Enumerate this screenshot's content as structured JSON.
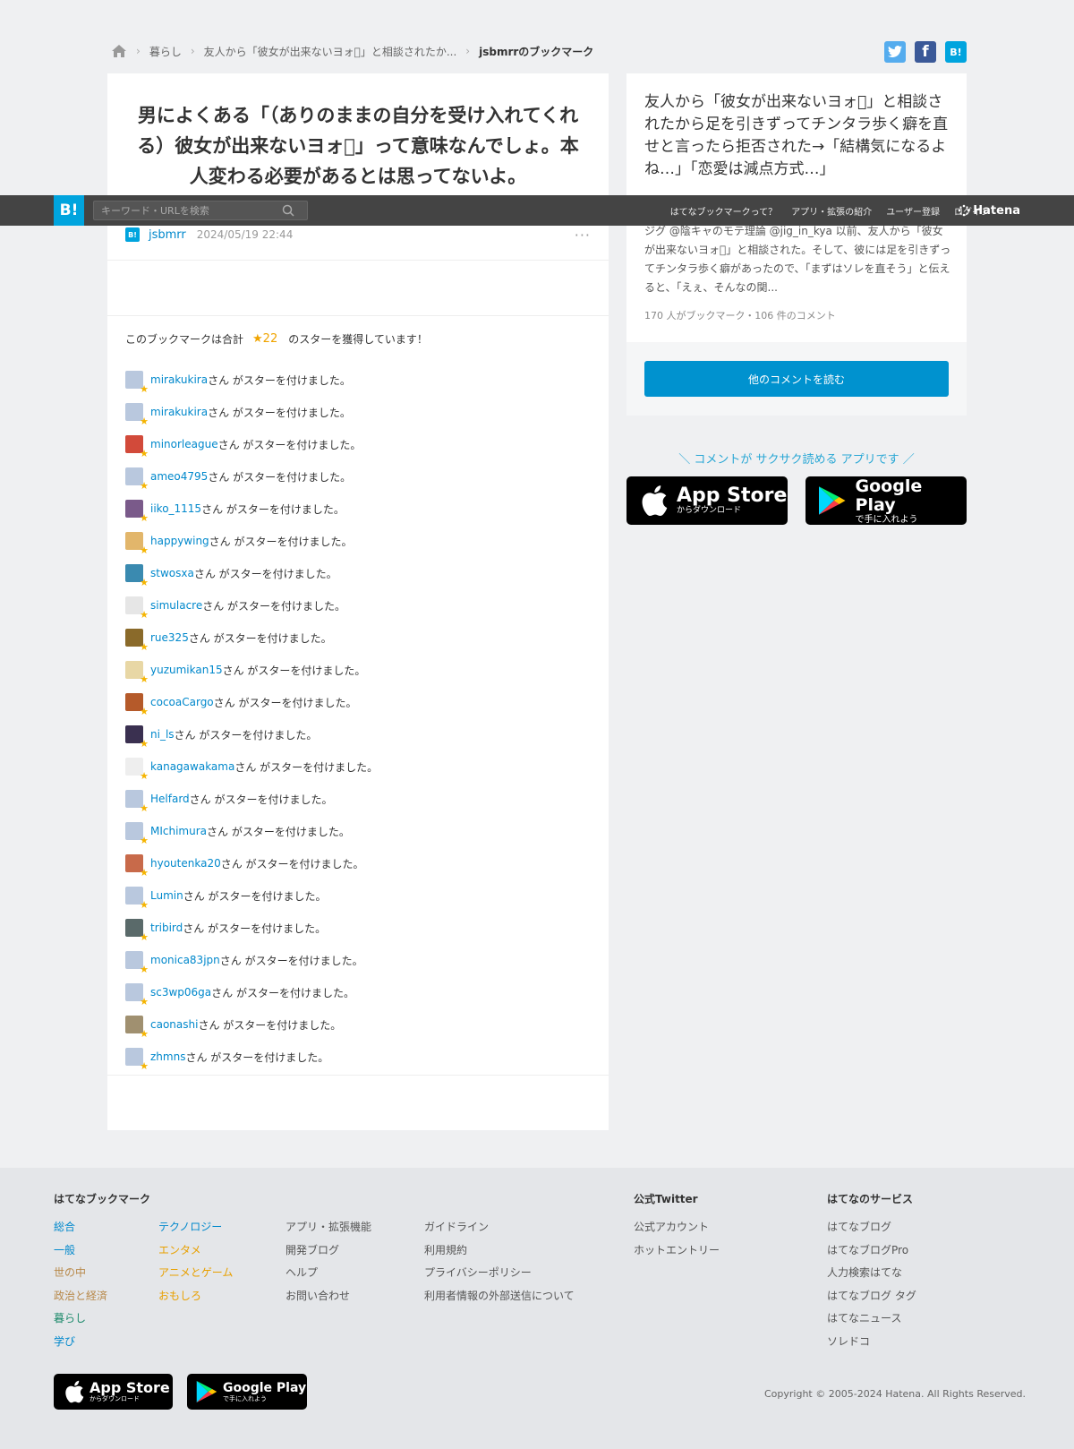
{
  "breadcrumb": {
    "items": [
      "暮らし",
      "友人から「彼女が出来ないヨォ\u0000」と相談されたか...",
      "jsbmrrのブックマーク"
    ]
  },
  "share": {
    "twitter": "t",
    "facebook": "f",
    "hatena": "B!"
  },
  "header": {
    "logo": "B!",
    "search_placeholder": "キーワード・URLを検索",
    "nav": [
      "はてなブックマークって？",
      "アプリ・拡張の紹介",
      "ユーザー登録",
      "ログイン"
    ],
    "brand": "Hatena"
  },
  "entry": {
    "title": "男によくある「（ありのままの自分を受け入れてくれる）彼女が出来ないヨォ\u0000」って意味なんでしょ。本人変わる必要があるとは思ってないよ。",
    "user": "jsbmrr",
    "timestamp": "2024/05/19 22:44",
    "more": "···",
    "star_summary_prefix": "このブックマークは合計",
    "star_count": "★22",
    "star_summary_suffix": "のスターを獲得しています！"
  },
  "stars": {
    "suffix": "さん がスターを付けました。",
    "users": [
      {
        "name": "mirakukira",
        "color": "#b9c8de"
      },
      {
        "name": "mirakukira",
        "color": "#b9c8de"
      },
      {
        "name": "minorleague",
        "color": "#d24a3a"
      },
      {
        "name": "ameo4795",
        "color": "#b9c8de"
      },
      {
        "name": "iiko_1115",
        "color": "#7a5a8a"
      },
      {
        "name": "happywing",
        "color": "#e2b66b"
      },
      {
        "name": "stwosxa",
        "color": "#3a8ab0"
      },
      {
        "name": "simulacre",
        "color": "#e6e6e6"
      },
      {
        "name": "rue325",
        "color": "#8a6a2a"
      },
      {
        "name": "yuzumikan15",
        "color": "#e8d7a5"
      },
      {
        "name": "cocoaCargo",
        "color": "#b55a2a"
      },
      {
        "name": "ni_ls",
        "color": "#3a3050"
      },
      {
        "name": "kanagawakama",
        "color": "#eeeeee"
      },
      {
        "name": "Helfard",
        "color": "#b9c8de"
      },
      {
        "name": "MIchimura",
        "color": "#b9c8de"
      },
      {
        "name": "hyoutenka20",
        "color": "#c86a4a"
      },
      {
        "name": "Lumin",
        "color": "#b9c8de"
      },
      {
        "name": "tribird",
        "color": "#5a6a6a"
      },
      {
        "name": "monica83jpn",
        "color": "#b9c8de"
      },
      {
        "name": "sc3wp06ga",
        "color": "#b9c8de"
      },
      {
        "name": "caonashi",
        "color": "#a09070"
      },
      {
        "name": "zhmns",
        "color": "#b9c8de"
      }
    ]
  },
  "side": {
    "title": "友人から「彼女が出来ないヨォ\u0000」と相談されたから足を引きずってチンタラ歩く癖を直せと言ったら拒否された→「結構気になるよね…」「恋愛は減点方式…」",
    "excerpt": "ジグ @陰キャのモテ理論 @jig_in_kya 以前、友人から「彼女が出来ないヨォ\u0000」と相談された。そして、彼には足を引きずってチンタラ歩く癖があったので、「まずはソレを直そう」と伝えると、「えぇ、そんなの関...",
    "stats": "170 人がブックマーク・106 件のコメント",
    "read_button": "他のコメントを読む"
  },
  "promo": {
    "text": "＼ コメントが サクサク読める アプリです ／",
    "appstore_main": "App Store",
    "appstore_sub": "からダウンロード",
    "googleplay_main": "Google Play",
    "googleplay_sub": "で手に入れよう"
  },
  "footer": {
    "col1_head": "はてなブックマーク",
    "cats_a": [
      "総合",
      "一般",
      "世の中",
      "政治と経済",
      "暮らし",
      "学び"
    ],
    "cats_b": [
      "テクノロジー",
      "エンタメ",
      "アニメとゲーム",
      "おもしろ"
    ],
    "links_a": [
      "アプリ・拡張機能",
      "開発ブログ",
      "ヘルプ",
      "お問い合わせ"
    ],
    "links_b": [
      "ガイドライン",
      "利用規約",
      "プライバシーポリシー",
      "利用者情報の外部送信について"
    ],
    "twitter_head": "公式Twitter",
    "twitter_links": [
      "公式アカウント",
      "ホットエントリー"
    ],
    "services_head": "はてなのサービス",
    "services": [
      "はてなブログ",
      "はてなブログPro",
      "人力検索はてな",
      "はてなブログ タグ",
      "はてなニュース",
      "ソレドコ"
    ],
    "copyright": "Copyright © 2005-2024 Hatena. All Rights Reserved."
  },
  "colors": {
    "brand": "#00a4de",
    "link": "#0088cc",
    "star": "#f5b400",
    "twitter": "#55acee",
    "facebook": "#3b5998"
  }
}
